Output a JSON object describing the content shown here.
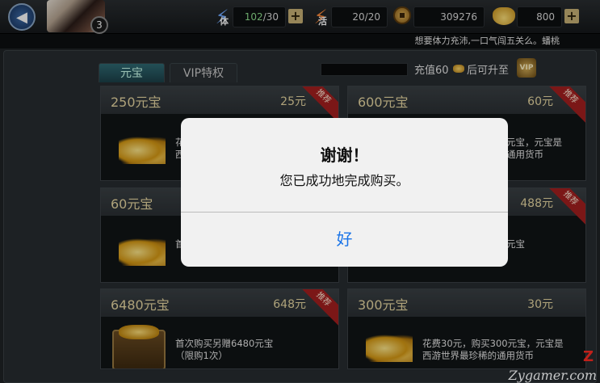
{
  "header": {
    "back_icon": "back-arrow-icon",
    "player_level": "3",
    "stamina": {
      "icon_label": "体",
      "value": "102",
      "max": "/30"
    },
    "energy": {
      "icon_label": "活",
      "value": "20/20"
    },
    "coins": "309276",
    "ingots": "800"
  },
  "ticker": "想要体力充沛,一口气闯五关么。蟠桃",
  "tabs": [
    {
      "label": "元宝",
      "active": true
    },
    {
      "label": "VIP特权",
      "active": false
    }
  ],
  "vip_prompt": {
    "before": "充值60",
    "after": "后可升至",
    "badge": "VIP"
  },
  "cards": [
    {
      "name": "250元宝",
      "price": "25元",
      "tag": "推荐",
      "desc": "花",
      "desc2": "西",
      "image": "gold-pile"
    },
    {
      "name": "600元宝",
      "price": "60元",
      "tag": "推荐",
      "desc": "元宝，元宝是",
      "desc2": "通用货币",
      "image": "gold-pile"
    },
    {
      "name": "60元宝",
      "price": "",
      "tag": "",
      "desc": "首",
      "desc2": "",
      "image": "gold-pile"
    },
    {
      "name": "",
      "price": "488元",
      "tag": "推荐",
      "desc": "元宝",
      "desc2": "",
      "image": "gold-pile"
    },
    {
      "name": "6480元宝",
      "price": "648元",
      "tag": "推荐",
      "desc": "首次购买另赠6480元宝",
      "desc2": "（限购1次）",
      "image": "treasure-chest"
    },
    {
      "name": "300元宝",
      "price": "30元",
      "tag": "",
      "desc": "花费30元，购买300元宝，元宝是",
      "desc2": "西游世界最珍稀的通用货币",
      "image": "gold-pile"
    }
  ],
  "dialog": {
    "title": "谢谢！",
    "message": "您已成功地完成购买。",
    "ok_label": "好"
  },
  "watermark": {
    "text": "Zygamer.com",
    "mark": "Z"
  },
  "colors": {
    "accent_blue": "#1a74e8",
    "ribbon_red": "#a41f1f",
    "gold_text": "#e9d9a3"
  }
}
